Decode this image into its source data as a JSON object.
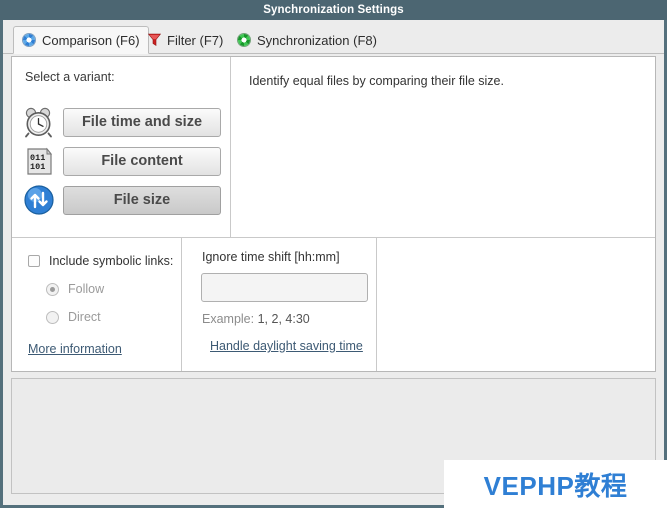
{
  "window": {
    "title": "Synchronization Settings"
  },
  "tabs": [
    {
      "label": "Comparison (F6)",
      "icon": "gear-blue-icon",
      "active": true
    },
    {
      "label": "Filter (F7)",
      "icon": "funnel-icon",
      "active": false
    },
    {
      "label": "Synchronization (F8)",
      "icon": "gear-green-icon",
      "active": false
    }
  ],
  "comparison": {
    "select_variant_label": "Select a variant:",
    "variants": [
      {
        "label": "File time and size",
        "icon": "alarm-clock-icon",
        "selected": false
      },
      {
        "label": "File content",
        "icon": "binary-file-icon",
        "selected": false
      },
      {
        "label": "File size",
        "icon": "blue-arrows-icon",
        "selected": true
      }
    ],
    "description": "Identify equal files by comparing their file size."
  },
  "symbolic_links": {
    "checkbox_label": "Include symbolic links:",
    "checked": false,
    "options": [
      {
        "label": "Follow",
        "selected": true
      },
      {
        "label": "Direct",
        "selected": false
      }
    ],
    "more_information_link": "More information"
  },
  "time_shift": {
    "label": "Ignore time shift [hh:mm]",
    "value": "",
    "placeholder": "",
    "example_prefix": "Example:",
    "example_values": "1, 2, 4:30",
    "daylight_link": "Handle daylight saving time"
  },
  "watermark": {
    "text": "VEPHP教程"
  },
  "colors": {
    "titlebar": "#4c6672",
    "dialog_border": "#54707c",
    "link": "#3d5a74",
    "watermark": "#2f7fd4",
    "panel_background": "#ffffff",
    "app_background": "#ececec"
  }
}
